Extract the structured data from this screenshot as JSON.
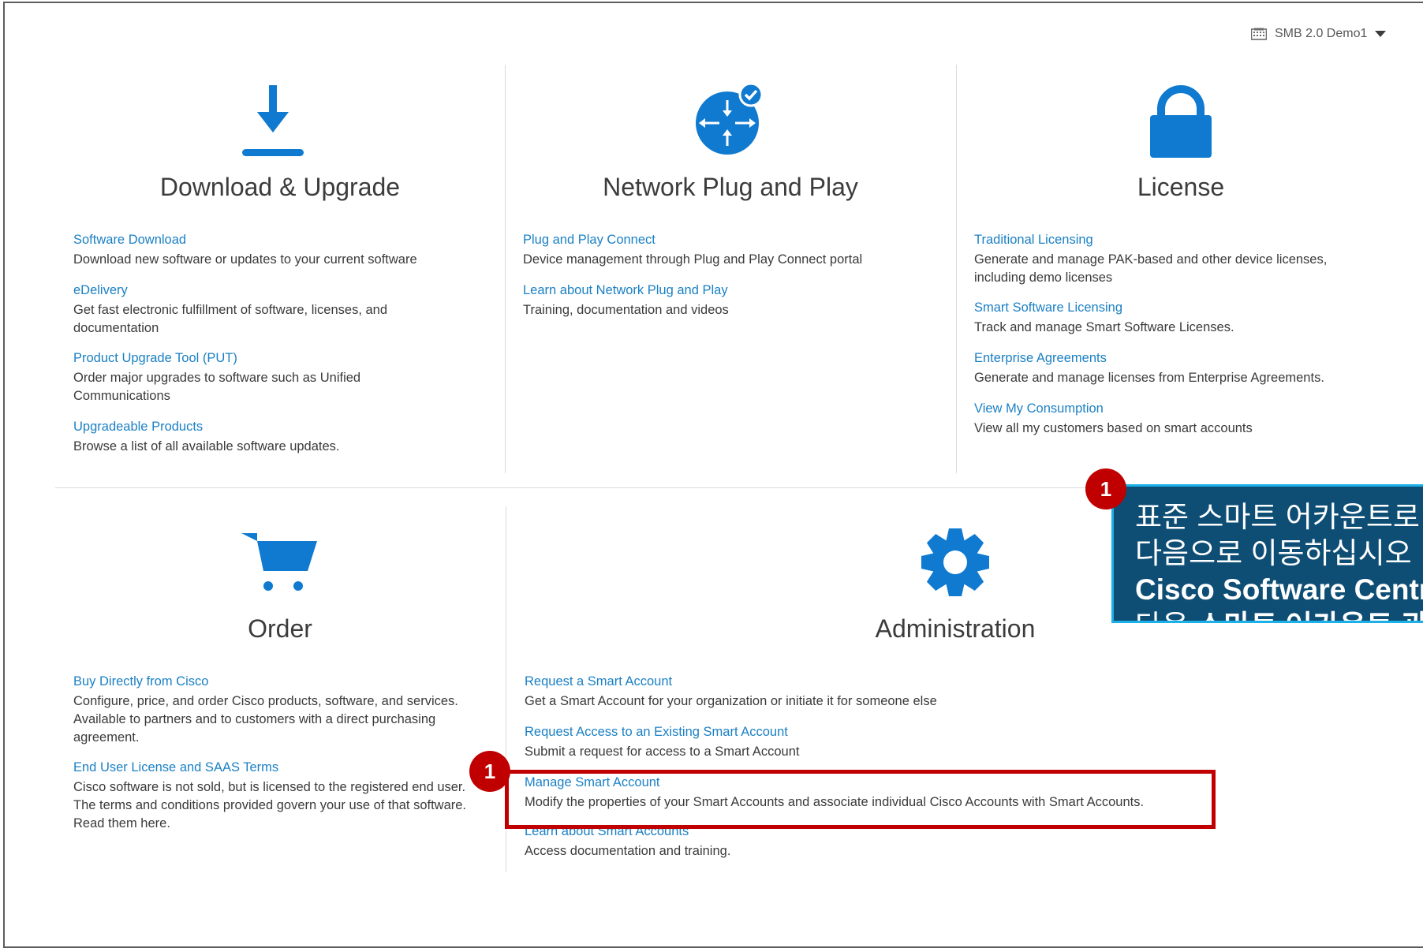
{
  "account": {
    "icon": "building-icon",
    "name": "SMB 2.0 Demo1",
    "dropdown_icon": "caret-down-icon"
  },
  "colors": {
    "link": "#1b80c4",
    "icon": "#0f7ad0",
    "callout_bg": "#0e4e75",
    "callout_border": "#1bb0e8",
    "badge": "#c00000",
    "highlight": "#c00000"
  },
  "tiles": {
    "download": {
      "icon": "download-icon",
      "title": "Download & Upgrade",
      "items": [
        {
          "link": "Software Download",
          "desc": "Download new software or updates to your current software"
        },
        {
          "link": "eDelivery",
          "desc": "Get fast electronic fulfillment of software, licenses, and documentation"
        },
        {
          "link": "Product Upgrade Tool (PUT)",
          "desc": "Order major upgrades to software such as Unified Communications"
        },
        {
          "link": "Upgradeable Products",
          "desc": "Browse a list of all available software updates."
        }
      ]
    },
    "pnp": {
      "icon": "network-router-check-icon",
      "title": "Network Plug and Play",
      "items": [
        {
          "link": "Plug and Play Connect",
          "desc": "Device management through Plug and Play Connect portal"
        },
        {
          "link": "Learn about Network Plug and Play",
          "desc": "Training, documentation and videos"
        }
      ]
    },
    "license": {
      "icon": "padlock-icon",
      "title": "License",
      "items": [
        {
          "link": "Traditional Licensing",
          "desc": "Generate and manage PAK-based and other device licenses, including demo licenses"
        },
        {
          "link": "Smart Software Licensing",
          "desc": "Track and manage Smart Software Licenses."
        },
        {
          "link": "Enterprise Agreements",
          "desc": "Generate and manage licenses from Enterprise Agreements."
        },
        {
          "link": "View My Consumption",
          "desc": "View all my customers based on smart accounts"
        }
      ]
    },
    "order": {
      "icon": "shopping-cart-icon",
      "title": "Order",
      "items": [
        {
          "link": "Buy Directly from Cisco",
          "desc": "Configure, price, and order Cisco products, software, and services. Available to partners and to customers with a direct purchasing agreement."
        },
        {
          "link": "End User License and SAAS Terms",
          "desc": "Cisco software is not sold, but is licensed to the registered end user. The terms and conditions provided govern your use of that software. Read them here."
        }
      ]
    },
    "admin": {
      "icon": "gear-icon",
      "title": "Administration",
      "items": [
        {
          "link": "Request a Smart Account",
          "desc": "Get a Smart Account for your organization or initiate it for someone else"
        },
        {
          "link": "Request Access to an Existing Smart Account",
          "desc": "Submit a request for access to a Smart Account"
        },
        {
          "link": "Manage Smart Account",
          "desc": "Modify the properties of your Smart Accounts and associate individual Cisco Accounts with Smart Accounts."
        },
        {
          "link": "Learn about Smart Accounts",
          "desc": "Access documentation and training."
        }
      ]
    }
  },
  "callout": {
    "badge": "1",
    "line1": "표준 스마트 어카운트로",
    "line2": "다음으로 이동하십시오",
    "line3_bold": "Cisco Software Central",
    "line4_prefix": "다음 ",
    "line4_bold": "스마트 어카운트 관리"
  },
  "highlight_badge": "1"
}
